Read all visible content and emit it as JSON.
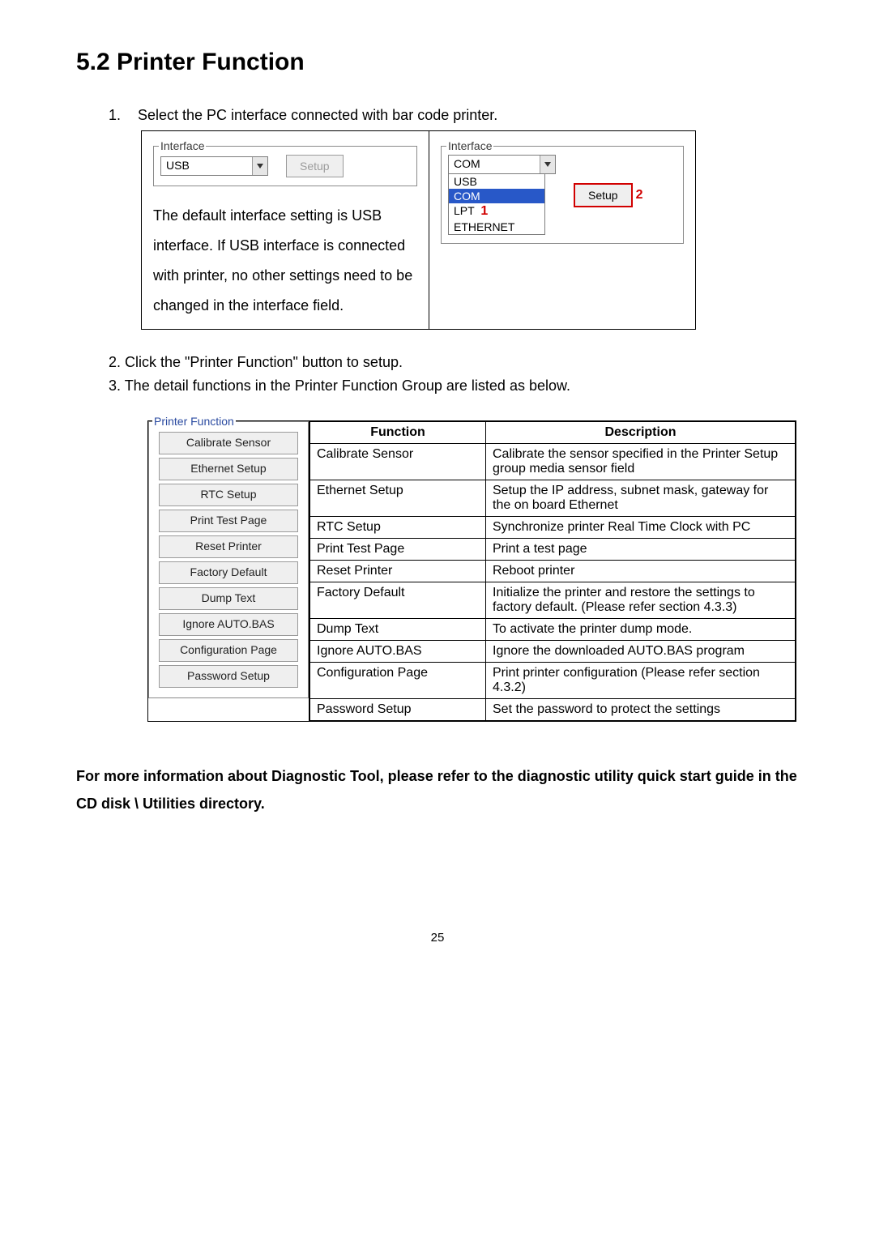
{
  "title": "5.2 Printer Function",
  "step1_num": "1.",
  "step1": "Select the PC interface connected with bar code printer.",
  "iface_left": {
    "legend": "Interface",
    "combo_value": "USB",
    "setup_label": "Setup",
    "desc": "The default interface setting is USB interface. If USB interface is connected with printer, no other settings need to be changed in the interface field."
  },
  "iface_right": {
    "legend": "Interface",
    "combo_value": "COM",
    "setup_label": "Setup",
    "red_num2": "2",
    "red_num1": "1",
    "opts": [
      "USB",
      "COM",
      "LPT",
      "ETHERNET"
    ]
  },
  "step2": "2. Click the \"Printer Function\" button to setup.",
  "step3": "3. The detail functions in the Printer Function Group are listed as below.",
  "panel": {
    "legend": "Printer Function",
    "buttons": [
      "Calibrate Sensor",
      "Ethernet Setup",
      "RTC Setup",
      "Print Test Page",
      "Reset Printer",
      "Factory Default",
      "Dump Text",
      "Ignore AUTO.BAS",
      "Configuration Page",
      "Password Setup"
    ]
  },
  "table": {
    "head_func": "Function",
    "head_desc": "Description",
    "rows": [
      {
        "f": "Calibrate Sensor",
        "d": "Calibrate the sensor specified in the Printer Setup group media sensor field"
      },
      {
        "f": "Ethernet Setup",
        "d": "Setup the IP address, subnet mask, gateway for the on board Ethernet"
      },
      {
        "f": "RTC Setup",
        "d": "Synchronize printer Real Time Clock with PC"
      },
      {
        "f": "Print Test Page",
        "d": "Print a test page"
      },
      {
        "f": "Reset Printer",
        "d": "Reboot printer"
      },
      {
        "f": "Factory Default",
        "d": "Initialize the printer and restore the settings to factory default. (Please refer section 4.3.3)"
      },
      {
        "f": "Dump Text",
        "d": "To activate the printer dump mode."
      },
      {
        "f": "Ignore AUTO.BAS",
        "d": "Ignore the downloaded AUTO.BAS program"
      },
      {
        "f": "Configuration Page",
        "d": "Print printer configuration (Please refer section 4.3.2)"
      },
      {
        "f": "Password Setup",
        "d": "Set the password to protect the settings"
      }
    ]
  },
  "note": "For more information about Diagnostic Tool, please refer to the diagnostic utility quick start guide in the CD disk \\ Utilities directory.",
  "page_number": "25"
}
